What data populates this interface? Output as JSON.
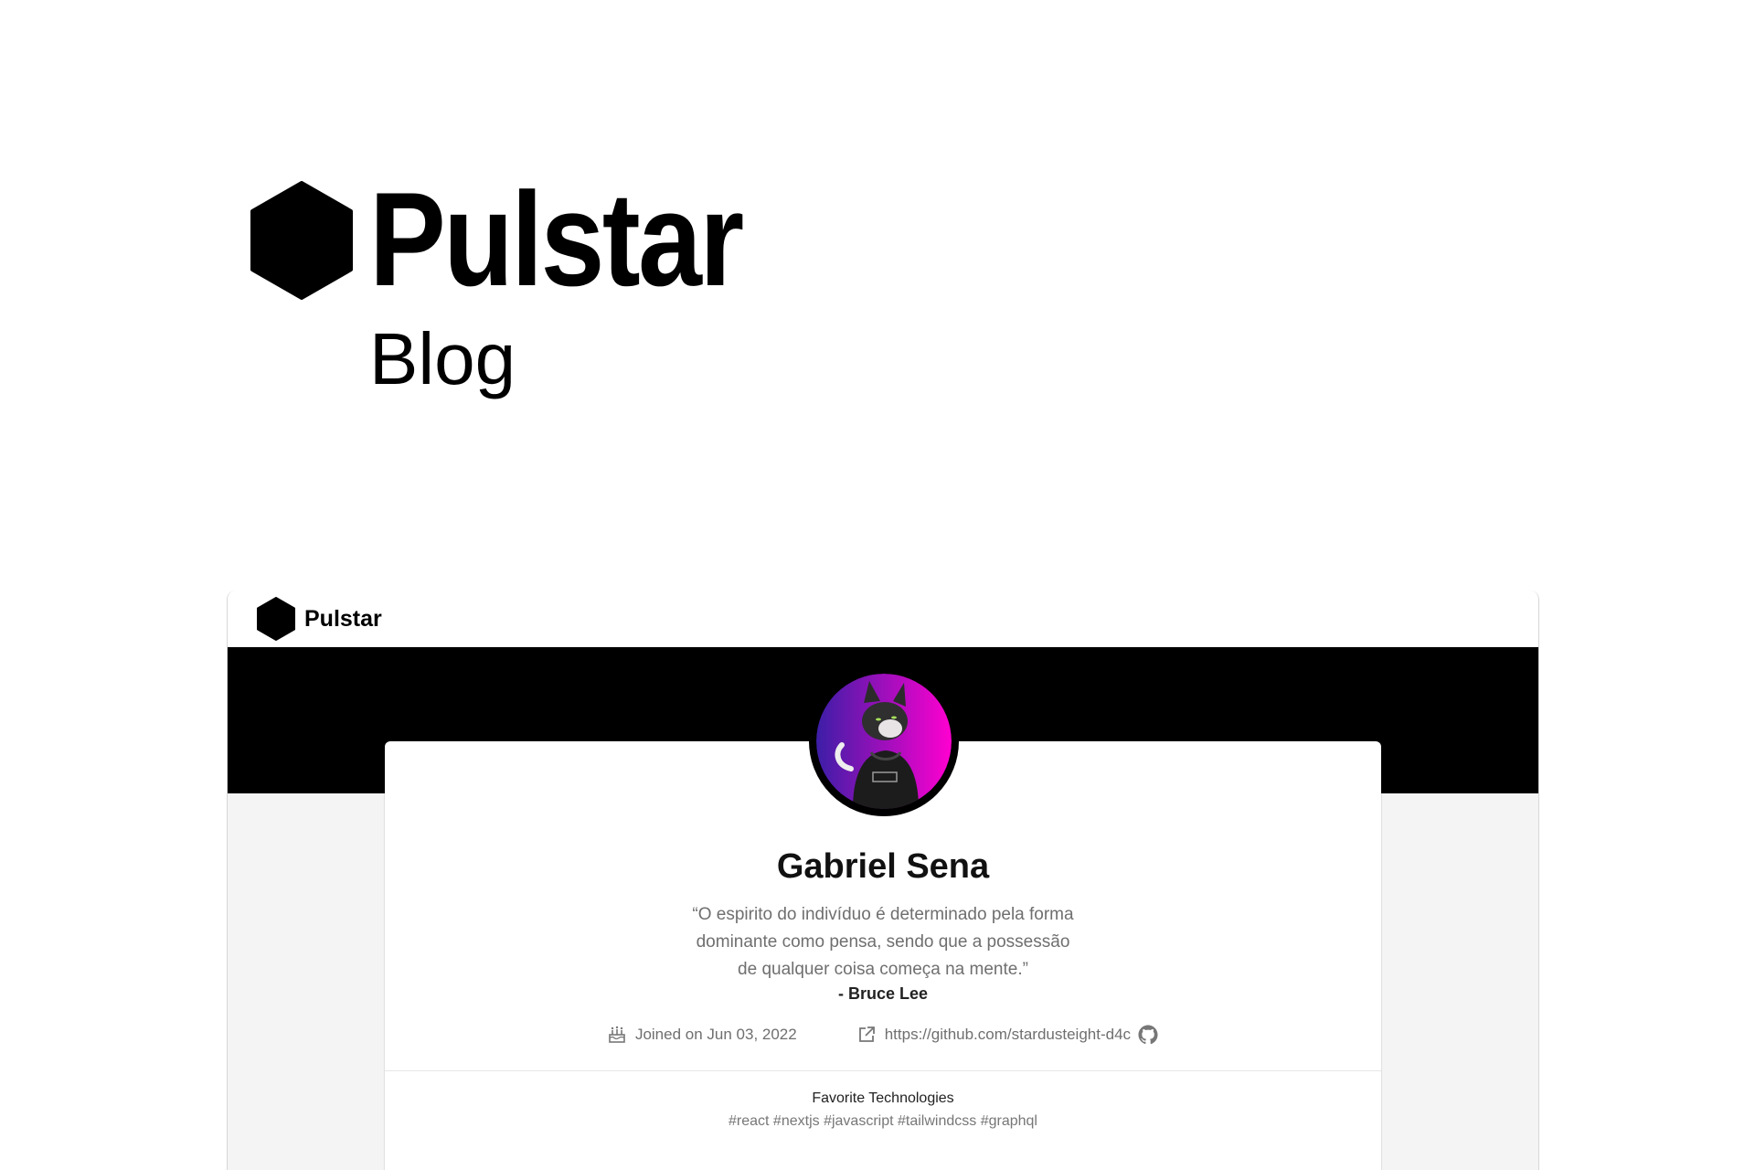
{
  "hero": {
    "title": "Pulstar",
    "subtitle": "Blog",
    "logo_icon": "hexagon-logo-icon"
  },
  "app": {
    "name": "Pulstar",
    "logo_icon": "hexagon-logo-icon"
  },
  "profile": {
    "avatar_icon": "cat-avatar-icon",
    "name": "Gabriel Sena",
    "quote_lines": [
      "“O espirito do indivíduo é determinado pela forma",
      "dominante como pensa, sendo que a possessão",
      "de qualquer coisa começa na mente.”"
    ],
    "quote_author": "- Bruce Lee",
    "joined": "Joined on Jun 03, 2022",
    "joined_icon": "cake-icon",
    "link": "https://github.com/stardusteight-d4c",
    "link_icon": "external-link-icon",
    "github_icon": "github-icon"
  },
  "technologies": {
    "title": "Favorite Technologies",
    "tags": "#react #nextjs #javascript #tailwindcss #graphql"
  },
  "colors": {
    "banner": "#000000",
    "page_background": "#f4f4f4",
    "avatar_gradient_start": "#3c1ea6",
    "avatar_gradient_end": "#ff00d0"
  }
}
